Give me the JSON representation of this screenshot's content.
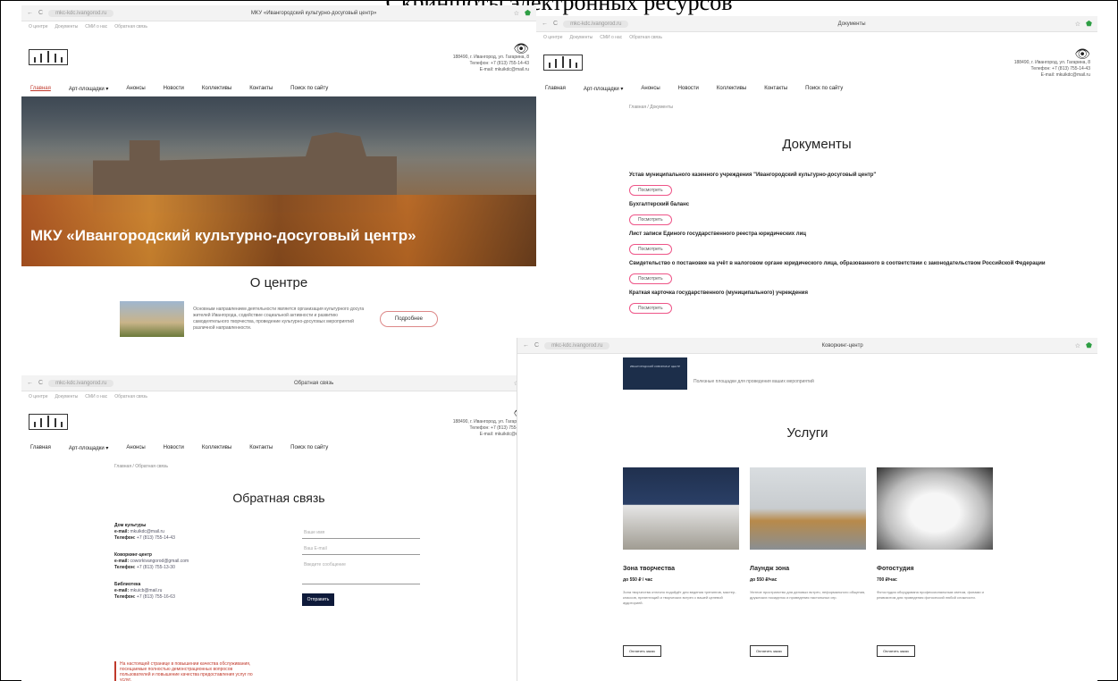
{
  "collage": {
    "title": "Скриншоты электронных ресурсов"
  },
  "chrome": {
    "url": "mkc-kdc.ivangorod.ru",
    "tab_home": "МКУ «Ивангородский культурно-досуговый центр»",
    "tab_docs": "Документы",
    "tab_feedback": "Обратная связь",
    "tab_services": "Коворкинг-центр",
    "back": "←",
    "reload": "C",
    "lock": "■",
    "star": "☆",
    "shield": "⬟",
    "menu": "⋮"
  },
  "header": {
    "util_links": [
      "О центре",
      "Документы",
      "СМИ о нас",
      "Обратная связь"
    ],
    "eye": "👁",
    "address": "188490, г. Ивангород, ул. Гагарина, 8",
    "phone": "Телефон: +7 (813) 755-14-43",
    "email": "E-mail: mkuikdc@mail.ru"
  },
  "nav": [
    "Главная",
    "Арт-площадки ▾",
    "Анонсы",
    "Новости",
    "Коллективы",
    "Контакты",
    "Поиск по сайту"
  ],
  "home": {
    "hero_title": "МКУ «Ивангородский культурно-досуговый центр»",
    "about_title": "О центре",
    "about_text": "Основным направлением деятельности является организация культурного досуга жителей Ивангорода, содействие социальной активности и развитию самодеятельного творчества, проведение культурно-досуговых мероприятий различной направленности.",
    "more_button": "Подробнее"
  },
  "docs": {
    "breadcrumb": "Главная / Документы",
    "title": "Документы",
    "items": [
      "Устав муниципального казенного учреждения \"Ивангородский культурно-досуговый центр\"",
      "Бухгалтерский баланс",
      "Лист записи Единого государственного реестра юридических лиц",
      "Свидетельство о постановке на учёт в налоговом органе юридического лица, образованного в соответствии с законодательством Российской Федерации",
      "Краткая карточка государственного (муниципального) учреждения"
    ],
    "view_button": "Посмотреть"
  },
  "feedback": {
    "breadcrumb": "Главная / Обратная связь",
    "title": "Обратная связь",
    "contacts": [
      {
        "name": "Дом культуры",
        "email_label": "e-mail:",
        "email": "mkuikdc@mail.ru",
        "phone_label": "Телефон:",
        "phone": "+7 (813) 755-14-43"
      },
      {
        "name": "Коворкинг-центр",
        "email_label": "e-mail:",
        "email": "coworkivangorod@gmail.com",
        "phone_label": "Телефон:",
        "phone": "+7 (813) 755-13-30"
      },
      {
        "name": "Библиотека",
        "email_label": "e-mail:",
        "email": "mkuicb@mail.ru",
        "phone_label": "Телефон:",
        "phone": "+7 (813) 755-16-63"
      }
    ],
    "name_placeholder": "Ваше имя",
    "email_placeholder": "Ваш E-mail",
    "message_placeholder": "Введите сообщение",
    "send_button": "Отправить",
    "note": "На настоящей странице в повышении качества обслуживания, посещаемые полностью демонстрационных вопросов пользователей и повышение качества предоставления услуг по услуг."
  },
  "services": {
    "promo_text": "ИВАНГОРОДСКИЙ КОВОРКИНГ ЦЕНТР",
    "promo_caption": "Полезные площадки для проведения ваших мероприятий",
    "title": "Услуги",
    "cards": [
      {
        "name": "Зона творчества",
        "price": "до 550 ₽ / час",
        "desc": "Зона творчества отлично подойдёт для ведения тренингов, мастер-классов, презентаций и творческих встреч с вашей целевой аудиторией.",
        "button": "Оплатить заказ"
      },
      {
        "name": "Лаундж зона",
        "price": "до 550 ₽/час",
        "desc": "Уютное пространство для деловых встреч, неформального общения, дружеских посиделок и проведения настольных игр.",
        "button": "Оплатить заказ"
      },
      {
        "name": "Фотостудия",
        "price": "700 ₽/час",
        "desc": "Фотостудия оборудована профессиональным светом, фонами и реквизитом для проведения фотосессий любой сложности.",
        "button": "Оплатить заказ"
      }
    ]
  },
  "colors": {
    "accent": "#c0392b",
    "dark_button": "#0e1a3a",
    "pill_border": "#e58"
  }
}
